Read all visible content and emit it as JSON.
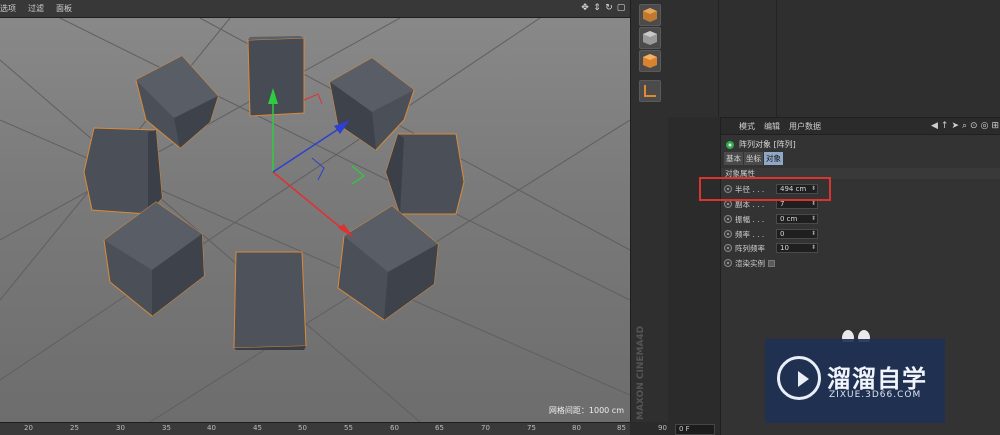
{
  "viewport": {
    "menu": [
      "选项",
      "过滤",
      "面板"
    ],
    "grid_spacing": "网格间距：1000 cm"
  },
  "timeline": {
    "ticks": [
      "20",
      "25",
      "30",
      "35",
      "40",
      "45",
      "50",
      "55",
      "60",
      "65",
      "70",
      "75",
      "80",
      "85",
      "90"
    ],
    "frame": "0 F"
  },
  "toolbar": {
    "logo_text": "MAXON CINEMA4D"
  },
  "attributes": {
    "menu": [
      "模式",
      "编辑",
      "用户数据"
    ],
    "object_title": "阵列对象 [阵列]",
    "tabs": [
      "基本",
      "坐标",
      "对象"
    ],
    "active_tab": "对象",
    "section_title": "对象属性",
    "params": [
      {
        "label": "半径 . . .",
        "value": "494 cm"
      },
      {
        "label": "副本 . . .",
        "value": "7"
      },
      {
        "label": "振幅 . . .",
        "value": "0 cm"
      },
      {
        "label": "频率 . . .",
        "value": "0"
      },
      {
        "label": "阵列频率",
        "value": "10"
      }
    ],
    "render_instances_label": "渲染实例"
  },
  "watermark": {
    "title": "溜溜自学",
    "url": "ZIXUE.3D66.COM"
  },
  "colors": {
    "highlight": "#d9352e",
    "cube_face": "#4d525b",
    "selection_outline": "#d98a3a",
    "axis_y": "#2ecc40",
    "axis_x": "#e03131",
    "axis_z": "#2f3fd0"
  }
}
